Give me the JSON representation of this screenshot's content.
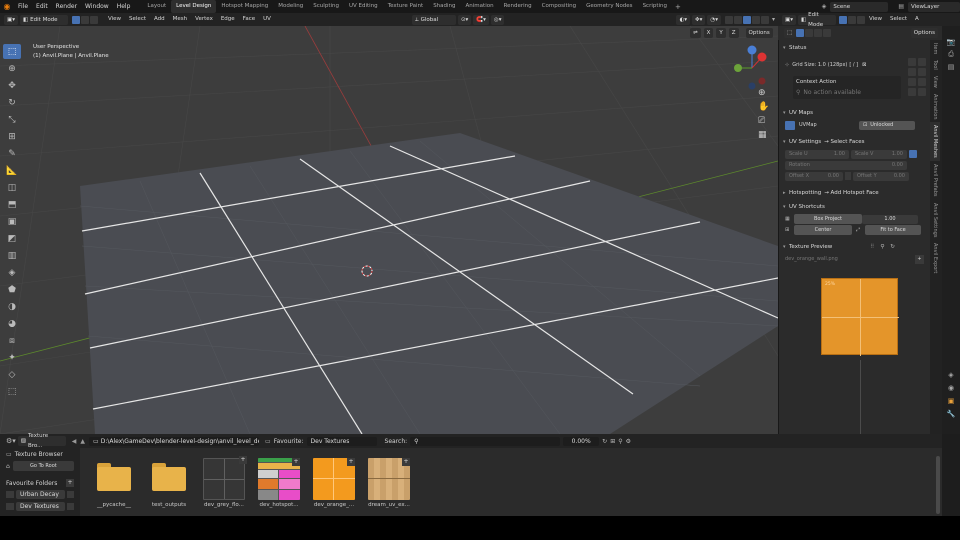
{
  "topbar": {
    "menus": [
      "File",
      "Edit",
      "Render",
      "Window",
      "Help"
    ],
    "workspaces": [
      "Layout",
      "Level Design",
      "Hotspot Mapping",
      "Modeling",
      "Sculpting",
      "UV Editing",
      "Texture Paint",
      "Shading",
      "Animation",
      "Rendering",
      "Compositing",
      "Geometry Nodes",
      "Scripting"
    ],
    "active_workspace": "Level Design",
    "scene": "Scene",
    "view_layer": "ViewLayer"
  },
  "viewport_header": {
    "mode": "Edit Mode",
    "menus": [
      "View",
      "Select",
      "Add",
      "Mesh",
      "Vertex",
      "Edge",
      "Face",
      "UV"
    ],
    "transform_orientation": "Global",
    "axes": [
      "X",
      "Y",
      "Z"
    ],
    "options": "Options"
  },
  "viewport": {
    "perspective": "User Perspective",
    "object": "(1) Anvil.Plane | Anvil.Plane",
    "gizmo_axes": [
      "X",
      "Y",
      "Z"
    ]
  },
  "right_header": {
    "mode": "Edit Mode",
    "menus": [
      "View",
      "Select"
    ],
    "options": "Options"
  },
  "npanel": {
    "status_title": "Status",
    "grid_size": "Grid Size: 1.0",
    "grid_px": "(128px)",
    "grid_sep": "[ / ]",
    "context_action": "Context Action",
    "no_action": "No action available",
    "uv_maps_title": "UV Maps",
    "uv_map_name": "UVMap",
    "uv_map_lock": "Unlocked",
    "uv_settings_title": "UV Settings",
    "uv_settings_target": "→ Select Faces",
    "scale_u_label": "Scale U",
    "scale_u": "1.00",
    "scale_v_label": "Scale V",
    "scale_v": "1.00",
    "rotation_label": "Rotation",
    "rotation": "0.00",
    "offset_x_label": "Offset X",
    "offset_x": "0.00",
    "offset_y_label": "Offset Y",
    "offset_y": "0.00",
    "hotspotting_title": "Hotspotting",
    "hotspotting_target": "→ Add Hotspot Face",
    "uv_shortcuts_title": "UV Shortcuts",
    "box_project": "Box Project",
    "box_value": "1.00",
    "center": "Center",
    "fit_to_face": "Fit to Face",
    "texture_preview_title": "Texture Preview",
    "texture_name": "dev_orange_wall.png",
    "texture_label": "25%"
  },
  "ntabs": [
    "Item",
    "Tool",
    "View",
    "Animation",
    "Anvil Meshes",
    "Anvil Prefabs",
    "Anvil Settings",
    "Anvil Export"
  ],
  "filebrowser": {
    "title": "Texture Bro...",
    "path": "D:\\Alex\\GameDev\\blender-level-design\\anvil_level_design\\...",
    "favourite_label": "Favourite:",
    "favourite_value": "Dev Textures",
    "search_label": "Search:",
    "search_placeholder": "",
    "zoom": "0.00%",
    "sidebar_title": "Texture Browser",
    "go_to_root": "Go To Root",
    "favourite_folders": "Favourite Folders",
    "folders": [
      "Urban Decay",
      "Dev Textures"
    ],
    "items": [
      {
        "label": "__pycache__",
        "kind": "folder"
      },
      {
        "label": "test_outputs",
        "kind": "folder"
      },
      {
        "label": "dev_grey_flo...",
        "kind": "grey"
      },
      {
        "label": "dev_hotspot...",
        "kind": "hotspot"
      },
      {
        "label": "dev_orange_...",
        "kind": "orange"
      },
      {
        "label": "dream_uv_ex...",
        "kind": "wood"
      }
    ]
  },
  "colors": {
    "accent": "#4772b3",
    "orange": "#f39a1e",
    "viewport_bg": "#3d3d3d"
  }
}
